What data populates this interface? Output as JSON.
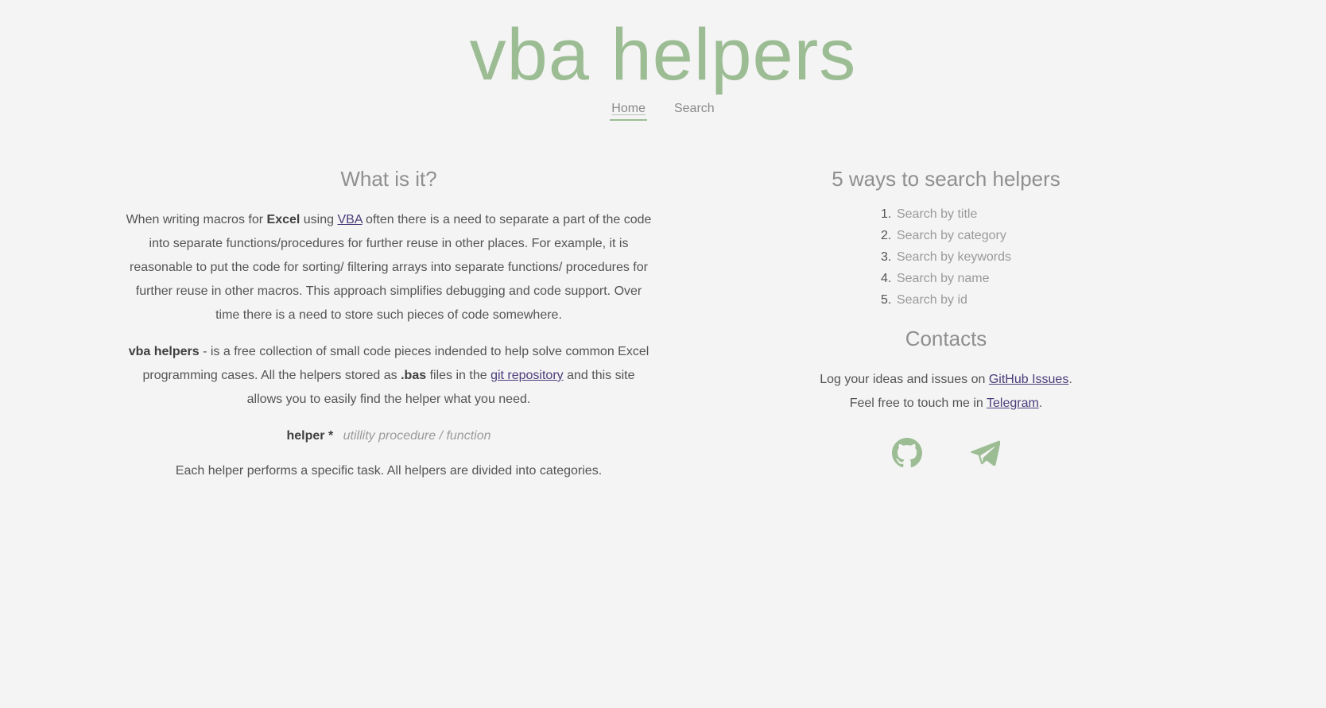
{
  "header": {
    "title": "vba helpers",
    "nav": [
      {
        "label": "Home"
      },
      {
        "label": "Search"
      }
    ]
  },
  "about": {
    "heading": "What is it?",
    "p1_a": "When writing macros for ",
    "p1_excel": "Excel",
    "p1_b": " using ",
    "p1_vba": "VBA",
    "p1_c": " often there is a need to separate a part of the code into separate functions/procedures for further reuse in other places. For example, it is reasonable to put the code for sorting/ filtering arrays into separate functions/ procedures for further reuse in other macros. This approach simplifies debugging and code support. Over time there is a need to store such pieces of code somewhere.",
    "p2_brand": "vba helpers",
    "p2_a": " - is a free collection of small code pieces indended to help solve common Excel programming cases. All the helpers stored as ",
    "p2_bas": ".bas",
    "p2_b": " files in the ",
    "p2_repo": "git repository",
    "p2_c": " and this site allows you to easily find the helper what you need.",
    "def_term": "helper *",
    "def_desc": "utillity procedure / function",
    "p3": "Each helper performs a specific task. All helpers are divided into categories."
  },
  "ways": {
    "heading": "5 ways to search helpers",
    "items": [
      {
        "num": "1.",
        "label": "Search by title"
      },
      {
        "num": "2.",
        "label": "Search by category"
      },
      {
        "num": "3.",
        "label": "Search by keywords"
      },
      {
        "num": "4.",
        "label": "Search by name"
      },
      {
        "num": "5.",
        "label": "Search by id"
      }
    ]
  },
  "contacts": {
    "heading": "Contacts",
    "line1_a": "Log your ideas and issues on ",
    "line1_link": "GitHub Issues",
    "line1_b": ".",
    "line2_a": "Feel free to touch me in ",
    "line2_link": "Telegram",
    "line2_b": "."
  },
  "icons": {
    "github": "github-icon",
    "telegram": "telegram-icon"
  },
  "colors": {
    "accent": "#9cbd94",
    "link": "#4b3c7a",
    "background": "#f4f4f4"
  }
}
